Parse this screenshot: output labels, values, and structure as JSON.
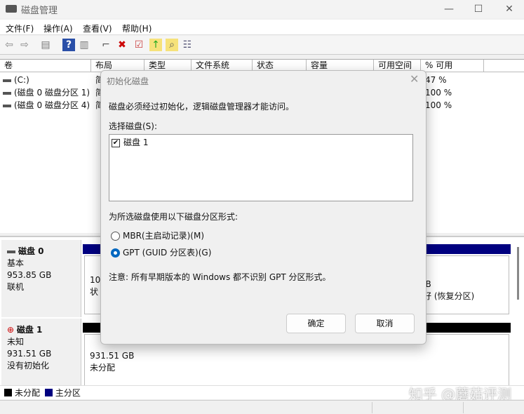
{
  "window": {
    "title": "磁盘管理"
  },
  "menu": [
    "文件(F)",
    "操作(A)",
    "查看(V)",
    "帮助(H)"
  ],
  "columns": [
    "卷",
    "布局",
    "类型",
    "文件系统",
    "状态",
    "容量",
    "可用空间",
    "% 可用"
  ],
  "volumes": [
    {
      "name": "(C:)",
      "layout": "简",
      "pct": "47 %"
    },
    {
      "name": "(磁盘 0 磁盘分区 1)",
      "layout": "简",
      "pct": "100 %"
    },
    {
      "name": "(磁盘 0 磁盘分区 4)",
      "layout": "简",
      "pct": "100 %"
    }
  ],
  "disks": [
    {
      "name": "磁盘 0",
      "type": "基本",
      "size": "953.85 GB",
      "status": "联机",
      "part_left": [
        "10",
        "状"
      ],
      "part_right": [
        "IB",
        "好 (恢复分区)"
      ]
    },
    {
      "name": "磁盘 1",
      "type": "未知",
      "size": "931.51 GB",
      "status": "没有初始化",
      "part": [
        "931.51 GB",
        "未分配"
      ]
    }
  ],
  "legend": [
    {
      "label": "未分配",
      "color": "#000000"
    },
    {
      "label": "主分区",
      "color": "#000080"
    }
  ],
  "dialog": {
    "title": "初始化磁盘",
    "message": "磁盘必须经过初始化，逻辑磁盘管理器才能访问。",
    "select_label": "选择磁盘(S):",
    "disk_item": "磁盘 1",
    "style_label": "为所选磁盘使用以下磁盘分区形式:",
    "mbr": "MBR(主启动记录)(M)",
    "gpt": "GPT (GUID 分区表)(G)",
    "note": "注意: 所有早期版本的 Windows 都不识别 GPT 分区形式。",
    "ok": "确定",
    "cancel": "取消"
  },
  "watermark": "知乎 @蘑菇评测"
}
